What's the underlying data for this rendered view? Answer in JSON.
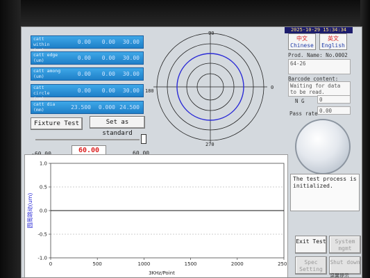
{
  "window": {
    "datetime": "2025-10-29 15:34:34"
  },
  "params": [
    {
      "label": "catt within (um)",
      "v1": "0.00",
      "v2": "0.00",
      "v3": "30.00"
    },
    {
      "label": "catt edge (um)",
      "v1": "0.00",
      "v2": "0.00",
      "v3": "30.00"
    },
    {
      "label": "catt among (um)",
      "v1": "0.00",
      "v2": "0.00",
      "v3": "30.00"
    },
    {
      "label": "catt circle (um)",
      "v1": "0.00",
      "v2": "0.00",
      "v3": "30.00"
    },
    {
      "label": "catt dia (mm)",
      "v1": "23.500",
      "v2": "0.000",
      "v3": "24.500"
    }
  ],
  "buttons": {
    "fixture_test": "Fixture Test",
    "set_standard": "Set as standard",
    "exit_test": "Exit Test",
    "system_mgmt": "System mgmt",
    "spec_setting": "Spec Setting",
    "shut_down": "Shut down",
    "lang_cn_top": "中文",
    "lang_cn_bottom": "Chinese",
    "lang_en_top": "英文",
    "lang_en_bottom": "English"
  },
  "slider": {
    "min": "-60.00",
    "max": "60.00",
    "value": "60.00"
  },
  "polar": {
    "top": "90",
    "left": "180",
    "right": "0",
    "bottom": "270"
  },
  "info": {
    "prod_name_label": "Prod. Name: No.0002",
    "prod_name_value": "64-26",
    "barcode_label": "Barcode content:",
    "barcode_value": "Waiting for data to be read.",
    "ng_label": "N G",
    "ng_value": "0",
    "pass_rate_label": "Pass rate",
    "pass_rate_value": "0.00"
  },
  "message": "The test process is initialized.",
  "chart_data": {
    "type": "line",
    "title": "",
    "xlabel": "3KHz/Point",
    "ylabel": "圆周跳动(um)",
    "xlim": [
      0,
      2500
    ],
    "ylim": [
      -1.0,
      1.0
    ],
    "x_ticks": [
      "0",
      "500",
      "1000",
      "1500",
      "2000",
      "2500"
    ],
    "y_ticks": [
      "1.0",
      "0.5",
      "0.0",
      "-0.5",
      "-1.0"
    ],
    "series": [
      {
        "values": [
          [
            0,
            0
          ],
          [
            2500,
            0
          ]
        ]
      }
    ],
    "grid": true
  },
  "colors": {
    "accent": "#1e7fc8",
    "value_red": "#d22222",
    "polar_blue": "#2b2bd6"
  },
  "bottom_hint": "温馨提示"
}
